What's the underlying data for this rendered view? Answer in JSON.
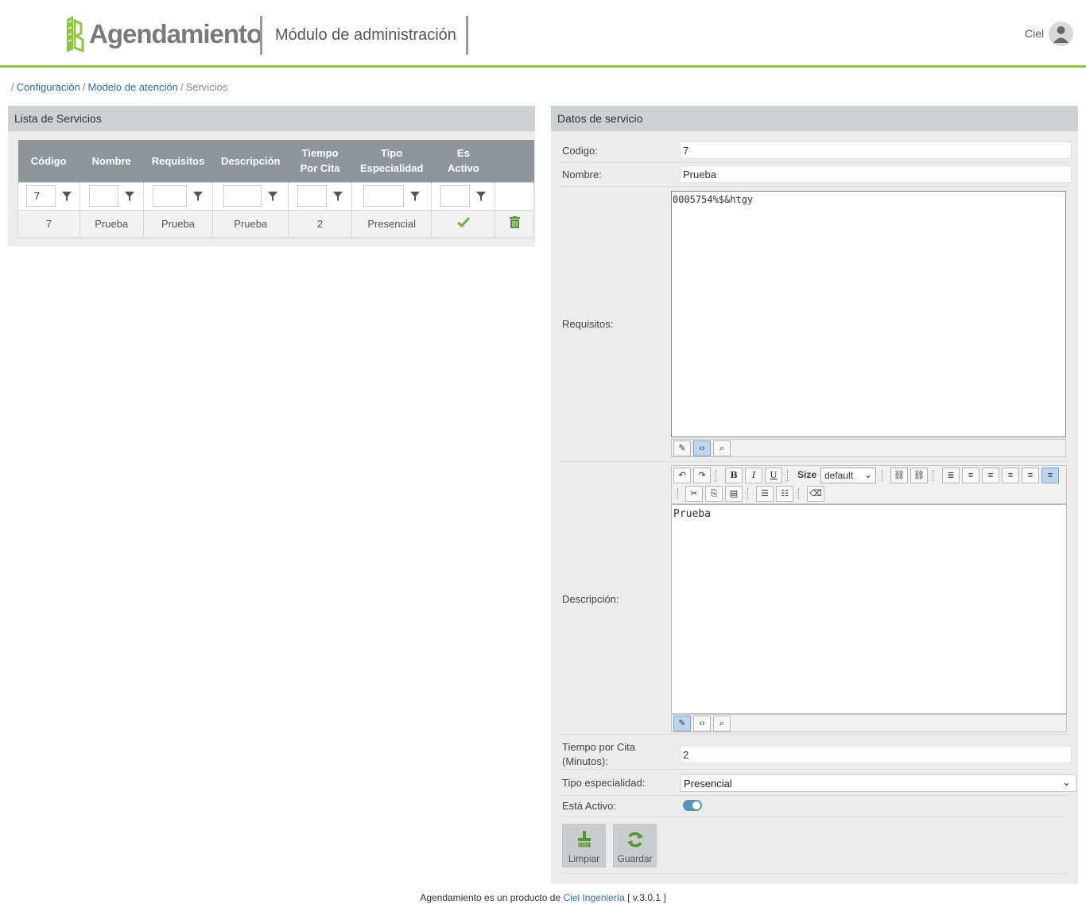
{
  "header": {
    "app_name": "Agendamiento",
    "module_title": "Módulo de administración",
    "user_name": "Ciel",
    "brand_color": "#8dc63f"
  },
  "breadcrumb": {
    "lead": "/",
    "items": [
      "Configuración",
      "Modelo de atención",
      "Servicios"
    ],
    "separator": "/"
  },
  "services_list": {
    "title": "Lista de Servicios",
    "columns": [
      "Código",
      "Nombre",
      "Requisitos",
      "Descripción",
      "Tiempo Por Cita",
      "Tipo Especialidad",
      "Es Activo"
    ],
    "filters": {
      "codigo": "7",
      "nombre": "",
      "requisitos": "",
      "descripcion": "",
      "tiempo": "",
      "tipo": "",
      "activo": ""
    },
    "rows": [
      {
        "codigo": "7",
        "nombre": "Prueba",
        "requisitos": "Prueba",
        "descripcion": "Prueba",
        "tiempo": "2",
        "tipo": "Presencial",
        "activo_icon": "check-icon",
        "delete_icon": "trash-icon"
      }
    ]
  },
  "service_form": {
    "title": "Datos de servicio",
    "codigo_label": "Codigo:",
    "codigo_value": "7",
    "nombre_label": "Nombre:",
    "nombre_value": "Prueba",
    "requisitos_label": "Requisitos:",
    "requisitos_value": "0005754%$&htgy",
    "descripcion_label": "Descripción:",
    "descripcion_value": "Prueba",
    "size_label": "Size",
    "size_value": "default",
    "tiempo_label_line1": "Tiempo por Cita",
    "tiempo_label_line2": "(Minutos):",
    "tiempo_value": "2",
    "tipo_label": "Tipo especialidad:",
    "tipo_value": "Presencial",
    "activo_label": "Está Activo:",
    "activo_value": true,
    "limpiar_label": "Limpiar",
    "guardar_label": "Guardar"
  },
  "footer": {
    "text_before": "Agendamiento es un producto de",
    "company_link": "Ciel Ingeniería",
    "version": "[ v.3.0.1 ]"
  },
  "colors": {
    "accent_green": "#8dc63f",
    "table_header": "#8e969b",
    "panel_header": "#cdd1d3",
    "link_blue": "#2a6fa8",
    "toggle_blue": "#5b93b4"
  }
}
